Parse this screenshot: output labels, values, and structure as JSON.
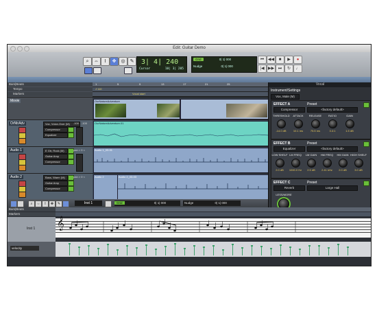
{
  "window": {
    "title": "Edit: Guitar Demo"
  },
  "counters": {
    "main": {
      "value": "3| 4| 240",
      "label": "Cursor",
      "sub": "10| 3| 205"
    },
    "grid": {
      "label": "Grid",
      "value": "0| 1| 000",
      "nudge_label": "Nudge",
      "nudge_value": "0| 1| 000"
    }
  },
  "rulers": {
    "bars_beats": "Bars|Beats",
    "tempo": "Tempo",
    "markers": "Markers",
    "tempo_value": "J 110",
    "marker_name": "Vocal start",
    "ticks": [
      "1",
      "5",
      "9",
      "13",
      "17",
      "21",
      "25"
    ]
  },
  "tracks": [
    {
      "name": "Movie",
      "clip": "OurNatureAdventure"
    },
    {
      "name": "OrNtrAdv",
      "clip": "OurNatureAdventure.01",
      "preset": "Vox, Voice-Over (M)",
      "plugins": [
        "Compressor",
        "Equalizer"
      ],
      "vol": "-100",
      "pan": "-100"
    },
    {
      "name": "Audio 1",
      "clip": "Audio 1_03-01",
      "preset": "E Gtr, Rock (M)",
      "plugins": [
        "Guitar Amp",
        "Compressor"
      ],
      "pan": "pan > 0 <"
    },
    {
      "name": "Audio 2",
      "clip": "Audio 2_03-03",
      "clip2": "Audio 2",
      "preset": "Bass, Warm (M)",
      "plugins": [
        "Guitar Amp",
        "Compressor"
      ],
      "pan": "pan > 0 <"
    }
  ],
  "plugin": {
    "header": "Vocal",
    "title": "Instrument/Settings",
    "preset_menu": "Vox, Male (M)",
    "effect_a": {
      "title": "EFFECT A",
      "preset_label": "Preset",
      "type": "Compressor",
      "preset": "<factory default>",
      "knobs": [
        {
          "label": "THRESHOLD",
          "value": "-14.0 dB"
        },
        {
          "label": "ATTACK",
          "value": "10.1 ms"
        },
        {
          "label": "RELEASE",
          "value": "75.5 ms"
        },
        {
          "label": "RATIO",
          "value": "3.4:1"
        },
        {
          "label": "GAIN",
          "value": "1.5 dB"
        }
      ]
    },
    "effect_b": {
      "title": "EFFECT B",
      "preset_label": "Preset",
      "type": "Equalizer",
      "preset": "<factory default>",
      "knobs": [
        {
          "label": "LOW SHELF",
          "value": "2.0 dB"
        },
        {
          "label": "LM FREQ",
          "value": "1000.0 Hz"
        },
        {
          "label": "LM GAIN",
          "value": "2.5 dB"
        },
        {
          "label": "HM FREQ",
          "value": "2.41 kHz"
        },
        {
          "label": "HM GAIN",
          "value": "2.0 dB"
        },
        {
          "label": "HIGH SHELF",
          "value": "3.0 dB"
        }
      ]
    },
    "effect_c": {
      "title": "EFFECT C",
      "preset_label": "Preset",
      "type": "Reverb",
      "preset": "Large Hall",
      "knob": {
        "label": "LESS/MORE",
        "value": "0.0 dB"
      }
    }
  },
  "midi": {
    "instrument": "Inst 1",
    "grid_label": "Grid",
    "grid_value": "0| 1| 000",
    "nudge_label": "Nudge",
    "nudge_value": "0| 1| 000",
    "bars_beats": "Bars|Beats",
    "markers": "Markers",
    "track_name": "Inst 1",
    "velocity": "velocity",
    "velocities": [
      0.9,
      0.6,
      0.75,
      0.5,
      0.85,
      0.4,
      0.7,
      0.55,
      0.8,
      0.45,
      0.65,
      0.9,
      0.5,
      0.7,
      0.6,
      0.75,
      0.4,
      0.85,
      0.55,
      0.7,
      0.65,
      0.5,
      0.8,
      0.6,
      0.45,
      0.75,
      0.7,
      0.55,
      0.85,
      0.6
    ]
  },
  "colors": {
    "accent": "#6abf3a",
    "clip": "#8fa7c9",
    "toolbar": "#a9aeb4"
  }
}
